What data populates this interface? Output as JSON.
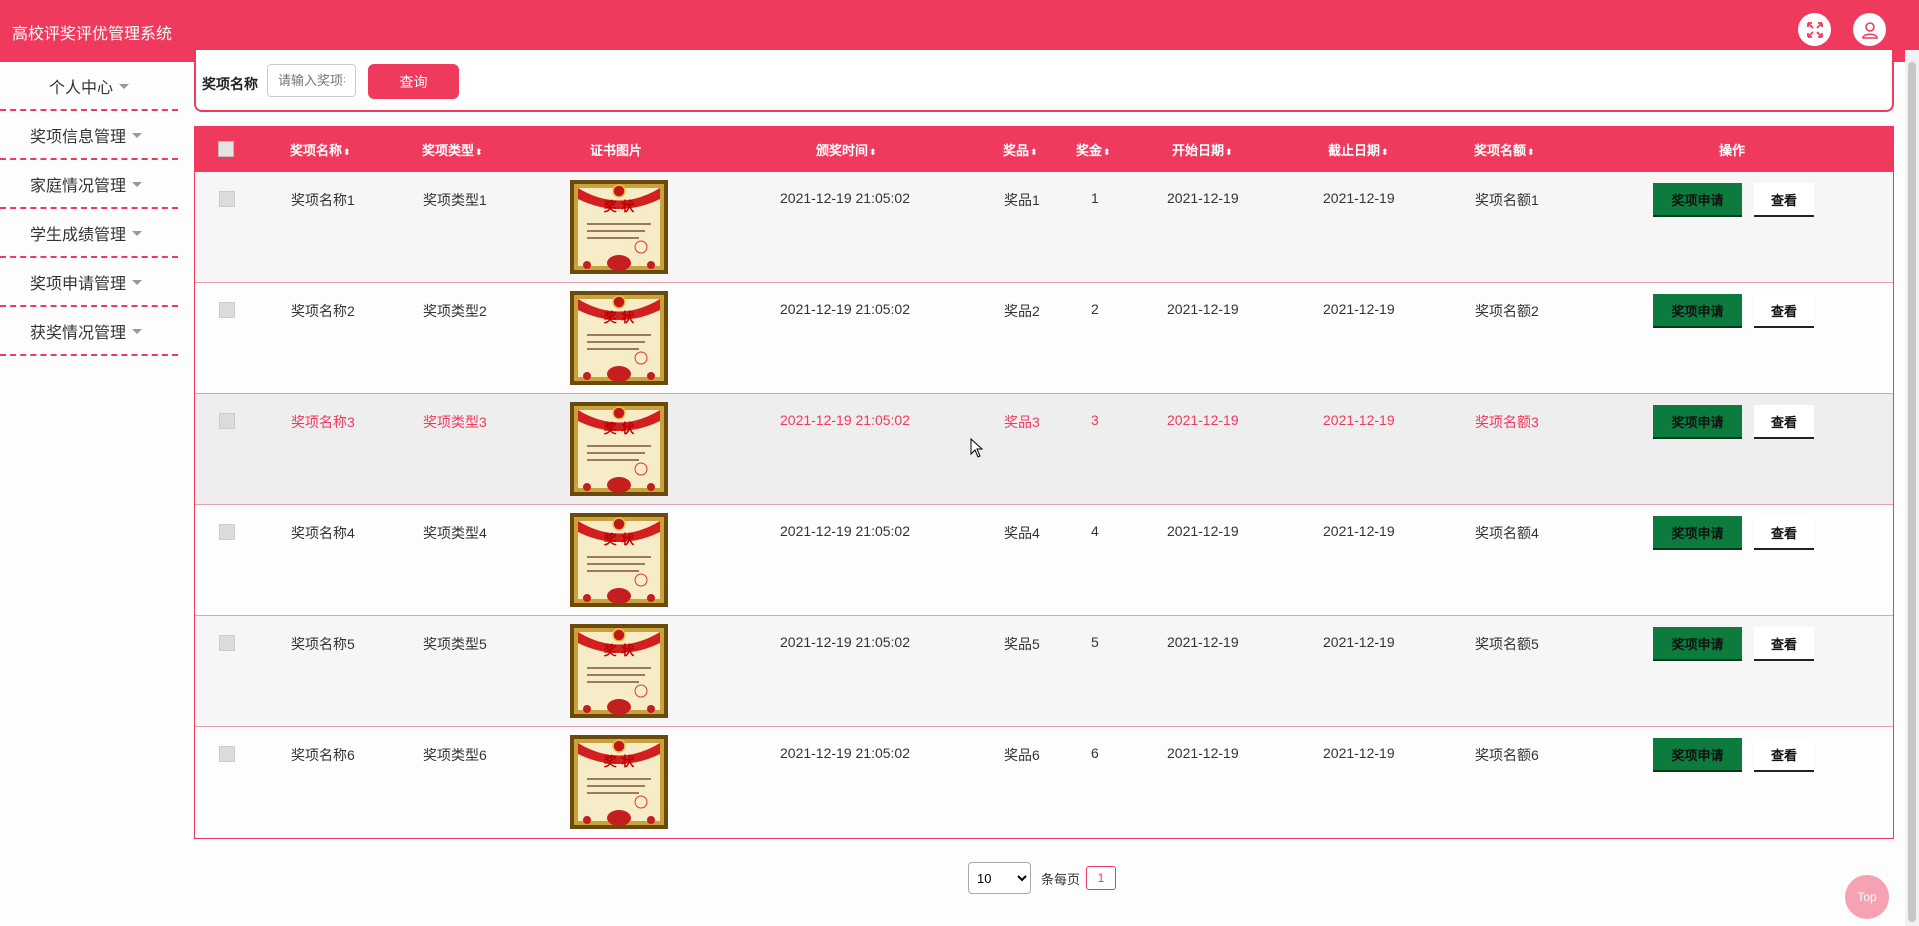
{
  "app": {
    "title": "高校评奖评优管理系统"
  },
  "header_icons": [
    "fullscreen-icon",
    "user-icon"
  ],
  "sidebar": {
    "items": [
      {
        "label": "个人中心"
      },
      {
        "label": "奖项信息管理"
      },
      {
        "label": "家庭情况管理"
      },
      {
        "label": "学生成绩管理"
      },
      {
        "label": "奖项申请管理"
      },
      {
        "label": "获奖情况管理"
      }
    ]
  },
  "search": {
    "label": "奖项名称",
    "placeholder": "请输入奖项名称",
    "button": "查询"
  },
  "table": {
    "headers": {
      "name": "奖项名称",
      "type": "奖项类型",
      "image": "证书图片",
      "award_time": "颁奖时间",
      "prize": "奖品",
      "bonus": "奖金",
      "start_date": "开始日期",
      "end_date": "截止日期",
      "quota": "奖项名额",
      "actions": "操作"
    },
    "rows": [
      {
        "name": "奖项名称1",
        "type": "奖项类型1",
        "award_time": "2021-12-19 21:05:02",
        "prize": "奖品1",
        "bonus": "1",
        "start_date": "2021-12-19",
        "end_date": "2021-12-19",
        "quota": "奖项名额1"
      },
      {
        "name": "奖项名称2",
        "type": "奖项类型2",
        "award_time": "2021-12-19 21:05:02",
        "prize": "奖品2",
        "bonus": "2",
        "start_date": "2021-12-19",
        "end_date": "2021-12-19",
        "quota": "奖项名额2"
      },
      {
        "name": "奖项名称3",
        "type": "奖项类型3",
        "award_time": "2021-12-19 21:05:02",
        "prize": "奖品3",
        "bonus": "3",
        "start_date": "2021-12-19",
        "end_date": "2021-12-19",
        "quota": "奖项名额3"
      },
      {
        "name": "奖项名称4",
        "type": "奖项类型4",
        "award_time": "2021-12-19 21:05:02",
        "prize": "奖品4",
        "bonus": "4",
        "start_date": "2021-12-19",
        "end_date": "2021-12-19",
        "quota": "奖项名额4"
      },
      {
        "name": "奖项名称5",
        "type": "奖项类型5",
        "award_time": "2021-12-19 21:05:02",
        "prize": "奖品5",
        "bonus": "5",
        "start_date": "2021-12-19",
        "end_date": "2021-12-19",
        "quota": "奖项名额5"
      },
      {
        "name": "奖项名称6",
        "type": "奖项类型6",
        "award_time": "2021-12-19 21:05:02",
        "prize": "奖品6",
        "bonus": "6",
        "start_date": "2021-12-19",
        "end_date": "2021-12-19",
        "quota": "奖项名额6"
      }
    ],
    "apply_label": "奖项申请",
    "view_label": "查看",
    "certificate_text": "奖 状"
  },
  "pagination": {
    "page_size": "10",
    "per_page_label": "条每页",
    "current_page": "1"
  },
  "back_to_top": "Top",
  "colors": {
    "primary": "#ef3a5d",
    "apply_button": "#0d7a3e"
  }
}
